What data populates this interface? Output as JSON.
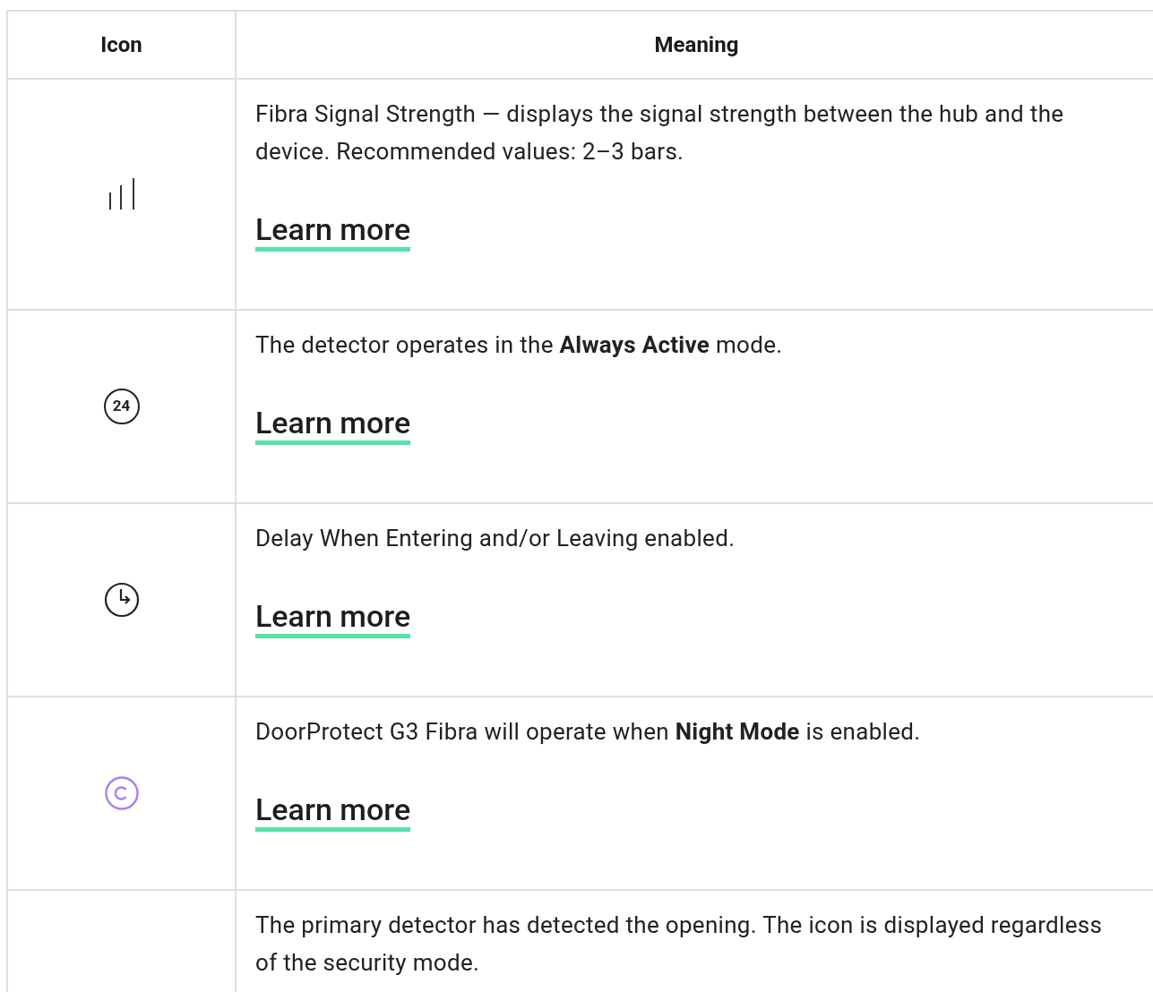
{
  "table": {
    "columns": [
      "Icon",
      "Meaning"
    ],
    "rows": [
      {
        "kind": "signal",
        "text": "Fibra Signal Strength — displays the signal strength between the hub and the device. Recommended values: 2–3 bars.",
        "link": "Learn more"
      },
      {
        "kind": "badge",
        "icon_text": "24",
        "text": "The detector operates in the **Always Active** mode.",
        "link": "Learn more"
      },
      {
        "kind": "clock",
        "text": "Delay When Entering and/or Leaving enabled.",
        "link": "Learn more"
      },
      {
        "kind": "ring",
        "text": "DoorProtect G3 Fibra will operate when **Night Mode** is enabled.",
        "link": "Learn more"
      },
      {
        "text": "The primary detector has detected the opening. The icon is displayed regardless of the security mode."
      }
    ]
  }
}
